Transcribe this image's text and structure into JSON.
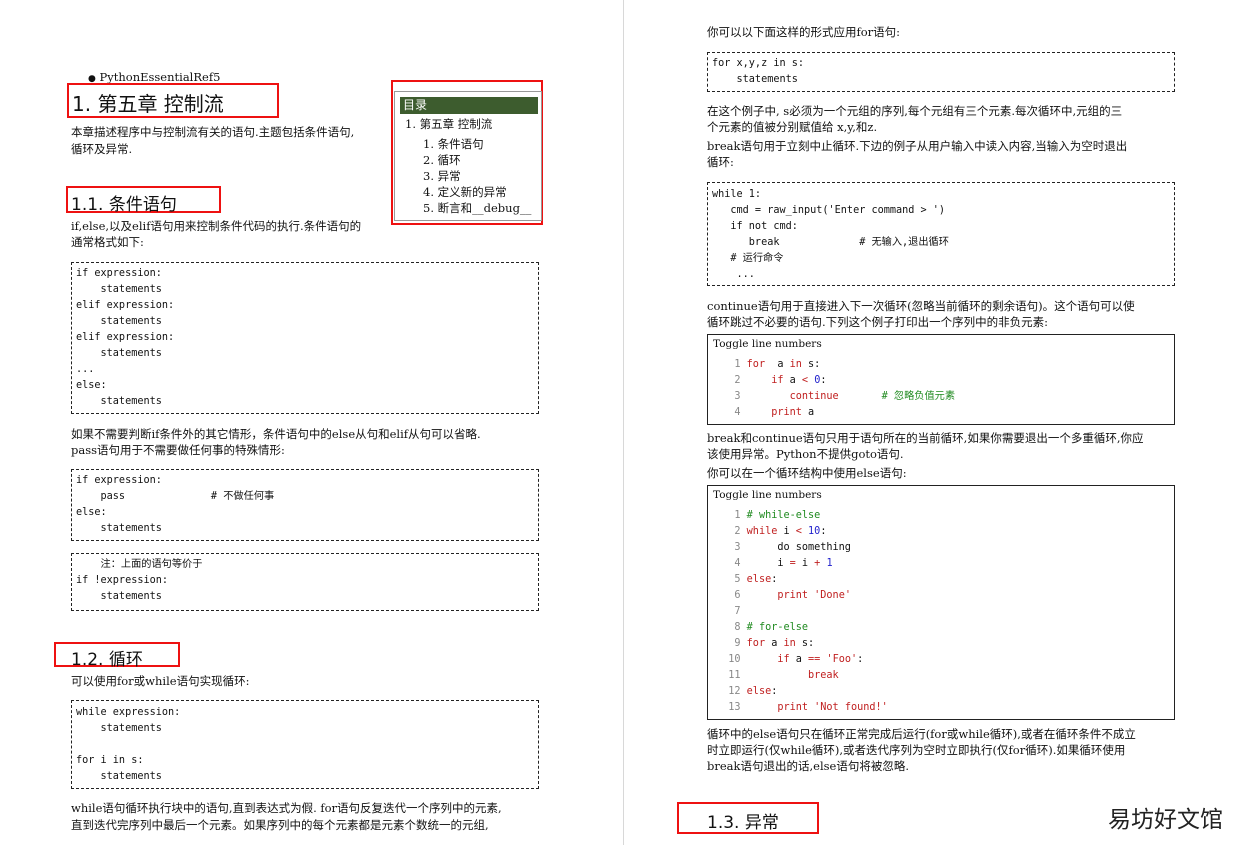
{
  "left": {
    "bullet": "PythonEssentialRef5",
    "h1": "1. 第五章 控制流",
    "intro": [
      "本章描述程序中与控制流有关的语句.主题包括条件语句,",
      "循环及异常."
    ],
    "toc": {
      "title": "目录",
      "items": [
        "1. 第五章 控制流",
        "1. 条件语句",
        "2. 循环",
        "3. 异常",
        "4. 定义新的异常",
        "5. 断言和__debug__"
      ]
    },
    "h2_1": "1.1. 条件语句",
    "cond_desc": [
      "if,else,以及elif语句用来控制条件代码的执行.条件语句的",
      "通常格式如下:"
    ],
    "code1": [
      "if expression:",
      "    statements",
      "elif expression:",
      "    statements",
      "elif expression:",
      "    statements",
      "...",
      "else:",
      "    statements"
    ],
    "else_desc": [
      "如果不需要判断if条件外的其它情形，条件语句中的else从句和elif从句可以省略.",
      "pass语句用于不需要做任何事的特殊情形:"
    ],
    "code2": [
      "if expression:",
      "    pass              # 不做任何事",
      "else:",
      "    statements"
    ],
    "code3": [
      "    注：上面的语句等价于",
      "if !expression:",
      "    statements"
    ],
    "h2_2": "1.2. 循环",
    "loop_desc": "可以使用for或while语句实现循环:",
    "code4": [
      "while expression:",
      "    statements",
      "",
      "for i in s:",
      "    statements"
    ],
    "while_desc": [
      "while语句循环执行块中的语句,直到表达式为假. for语句反复迭代一个序列中的元素,",
      "直到迭代完序列中最后一个元素。如果序列中的每个元素都是元素个数统一的元组,"
    ]
  },
  "right": {
    "for_desc": "你可以以下面这样的形式应用for语句:",
    "code5": [
      "for x,y,z in s:",
      "    statements"
    ],
    "tuple_desc": [
      "在这个例子中, s必须为一个元组的序列,每个元组有三个元素.每次循环中,元组的三",
      "个元素的值被分别赋值给 x,y,和z."
    ],
    "break_desc": [
      "break语句用于立刻中止循环.下边的例子从用户输入中读入内容,当输入为空时退出",
      "循环:"
    ],
    "code6": [
      "while 1:",
      "   cmd = raw_input('Enter command > ')",
      "   if not cmd:",
      "      break             # 无输入,退出循环",
      "   # 运行命令",
      "    ..."
    ],
    "continue_desc": [
      "continue语句用于直接进入下一次循环(忽略当前循环的剩余语句)。这个语句可以使",
      "循环跳过不必要的语句.下列这个例子打印出一个序列中的非负元素:"
    ],
    "toggle": "Toggle line numbers",
    "code7": [
      {
        "n": "1",
        "parts": [
          [
            "kw",
            "for"
          ],
          [
            "",
            "  a "
          ],
          [
            "kw",
            "in"
          ],
          [
            "",
            " s:"
          ]
        ]
      },
      {
        "n": "2",
        "parts": [
          [
            "",
            "    "
          ],
          [
            "kw",
            "if"
          ],
          [
            "",
            " a "
          ],
          [
            "kw",
            "<"
          ],
          [
            "",
            " "
          ],
          [
            "nm",
            "0"
          ],
          [
            "",
            ":"
          ]
        ]
      },
      {
        "n": "3",
        "parts": [
          [
            "",
            "       "
          ],
          [
            "kw",
            "continue"
          ],
          [
            "",
            "       "
          ],
          [
            "cm",
            "# 忽略负值元素"
          ]
        ]
      },
      {
        "n": "4",
        "parts": [
          [
            "",
            "    "
          ],
          [
            "kw",
            "print"
          ],
          [
            "",
            " a"
          ]
        ]
      }
    ],
    "multi_desc": [
      "break和continue语句只用于语句所在的当前循环,如果你需要退出一个多重循环,你应",
      "该使用异常。Python不提供goto语句."
    ],
    "else_loop_desc": "你可以在一个循环结构中使用else语句:",
    "code8": [
      {
        "n": "1",
        "parts": [
          [
            "cm",
            "# while-else"
          ]
        ]
      },
      {
        "n": "2",
        "parts": [
          [
            "kw",
            "while"
          ],
          [
            "",
            " i "
          ],
          [
            "kw",
            "<"
          ],
          [
            "",
            " "
          ],
          [
            "nm",
            "10"
          ],
          [
            "",
            ":"
          ]
        ]
      },
      {
        "n": "3",
        "parts": [
          [
            "",
            "     do something"
          ]
        ]
      },
      {
        "n": "4",
        "parts": [
          [
            "",
            "     i "
          ],
          [
            "kw",
            "="
          ],
          [
            "",
            " i "
          ],
          [
            "kw",
            "+"
          ],
          [
            "",
            " "
          ],
          [
            "nm",
            "1"
          ]
        ]
      },
      {
        "n": "5",
        "parts": [
          [
            "kw",
            "else"
          ],
          [
            "",
            ":"
          ]
        ]
      },
      {
        "n": "6",
        "parts": [
          [
            "",
            "     "
          ],
          [
            "kw",
            "print"
          ],
          [
            "",
            " "
          ],
          [
            "str",
            "'Done'"
          ]
        ]
      },
      {
        "n": "7",
        "parts": [
          [
            "",
            ""
          ]
        ]
      },
      {
        "n": "8",
        "parts": [
          [
            "cm",
            "# for-else"
          ]
        ]
      },
      {
        "n": "9",
        "parts": [
          [
            "kw",
            "for"
          ],
          [
            "",
            " a "
          ],
          [
            "kw",
            "in"
          ],
          [
            "",
            " s:"
          ]
        ]
      },
      {
        "n": "10",
        "parts": [
          [
            "",
            "     "
          ],
          [
            "kw",
            "if"
          ],
          [
            "",
            " a "
          ],
          [
            "kw",
            "=="
          ],
          [
            "",
            " "
          ],
          [
            "str",
            "'Foo'"
          ],
          [
            "",
            ":"
          ]
        ]
      },
      {
        "n": "11",
        "parts": [
          [
            "",
            "          "
          ],
          [
            "kw",
            "break"
          ]
        ]
      },
      {
        "n": "12",
        "parts": [
          [
            "kw",
            "else"
          ],
          [
            "",
            ":"
          ]
        ]
      },
      {
        "n": "13",
        "parts": [
          [
            "",
            "     "
          ],
          [
            "kw",
            "print"
          ],
          [
            "",
            " "
          ],
          [
            "str",
            "'Not found!'"
          ]
        ]
      }
    ],
    "else_run_desc": [
      "循环中的else语句只在循环正常完成后运行(for或while循环),或者在循环条件不成立",
      "时立即运行(仅while循环),或者迭代序列为空时立即执行(仅for循环).如果循环使用",
      "break语句退出的话,else语句将被忽略."
    ],
    "h2_3": "1.3. 异常",
    "watermark": "易坊好文馆"
  }
}
